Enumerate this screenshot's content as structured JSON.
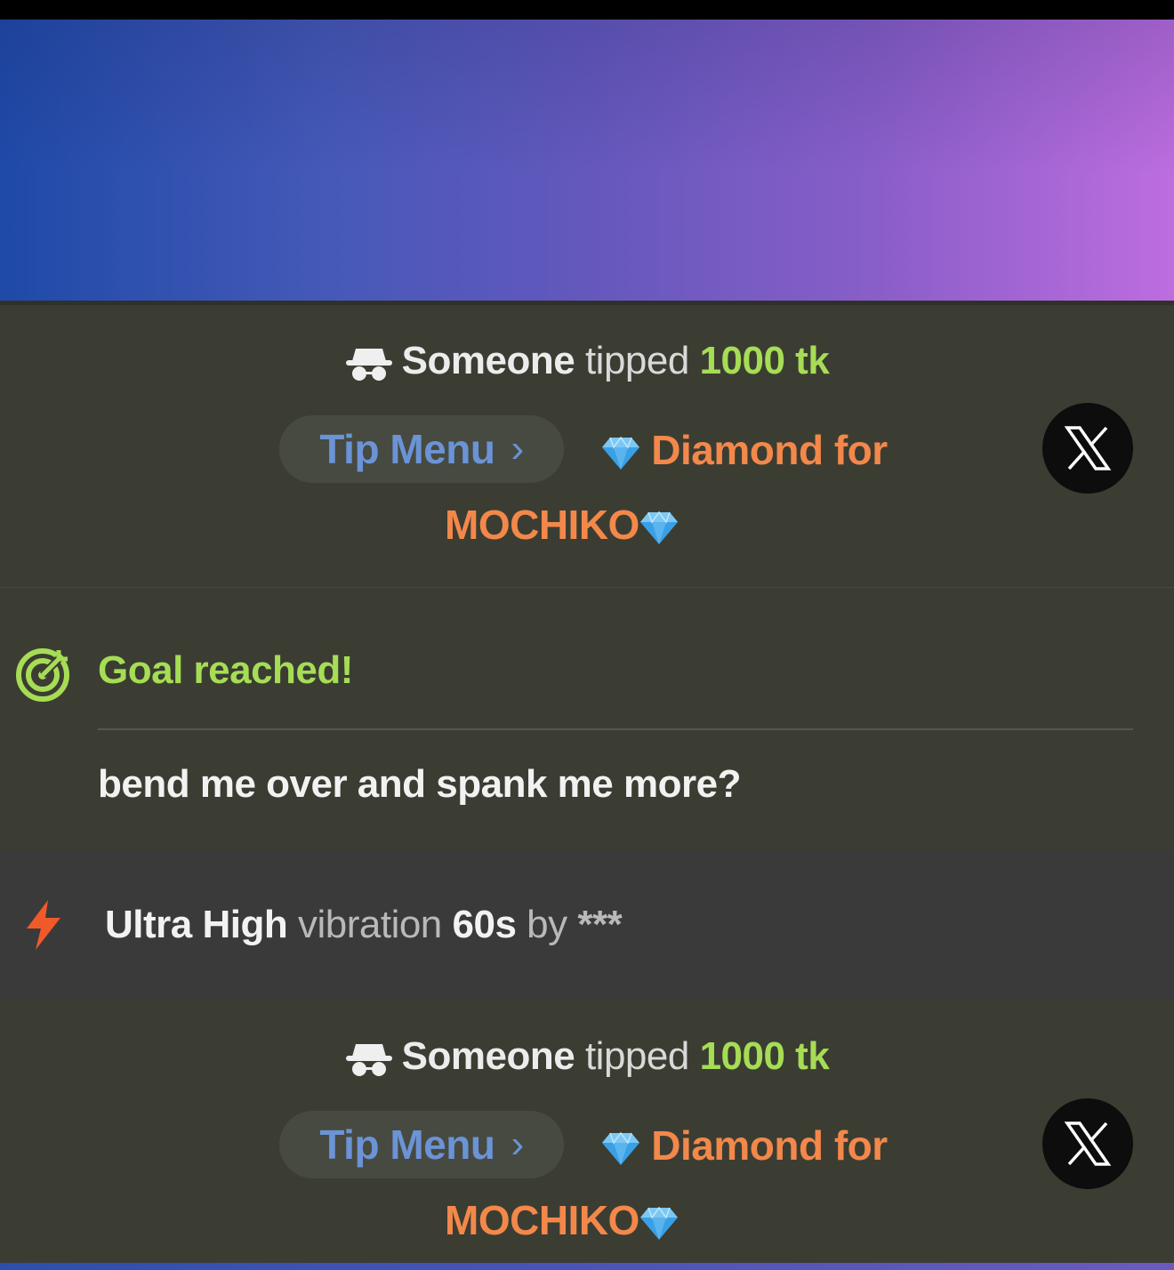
{
  "colors": {
    "amount": "#a6dd55",
    "reward": "#f3884a",
    "menu_link": "#6b93d6",
    "goal": "#a6dd55",
    "bolt": "#f05a2a"
  },
  "tips": [
    {
      "icon": "incognito-icon",
      "user": "Someone",
      "verb": "tipped",
      "amount": "1000 tk",
      "menu_label": "Tip Menu",
      "menu_chevron": "›",
      "reward_text": "Diamond for",
      "reward_name": "MOCHIKO",
      "share_icon": "x-logo-icon"
    },
    {
      "icon": "incognito-icon",
      "user": "Someone",
      "verb": "tipped",
      "amount": "1000 tk",
      "menu_label": "Tip Menu",
      "menu_chevron": "›",
      "reward_text": "Diamond for",
      "reward_name": "MOCHIKO",
      "share_icon": "x-logo-icon"
    }
  ],
  "goal": {
    "icon": "target-icon",
    "title": "Goal reached!",
    "text": "bend me over and spank me more?"
  },
  "vibration": {
    "icon": "lightning-icon",
    "level": "Ultra High",
    "label": "vibration",
    "duration": "60s",
    "by": "by",
    "user": "***"
  }
}
